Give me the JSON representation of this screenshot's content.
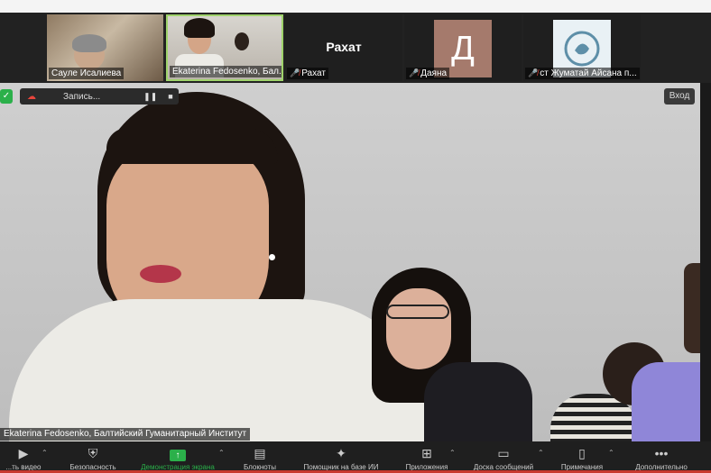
{
  "participants": [
    {
      "name": "Сауле Исалиева",
      "type": "video"
    },
    {
      "name": "Ekaterina Fedosenko, Бал...",
      "type": "video"
    },
    {
      "name": "Рахат",
      "display": "Рахат",
      "type": "name",
      "muted": true
    },
    {
      "name": "Даяна",
      "avatar_letter": "Д",
      "type": "avatar",
      "muted": true
    },
    {
      "name": "ст Жуматай Айсана п...",
      "type": "logo",
      "muted": true
    }
  ],
  "recording": {
    "label": "Запись..."
  },
  "enter_button": "Вход",
  "speaker_label": "Ekaterina Fedosenko, Балтийский Гуманитарный Институт",
  "toolbar": [
    {
      "label": "...ть видео",
      "icon": "video-camera-icon"
    },
    {
      "label": "Безопасность",
      "icon": "shield-icon"
    },
    {
      "label": "Демонстрация экрана",
      "icon": "share-screen-icon"
    },
    {
      "label": "Блокноты",
      "icon": "notebook-icon"
    },
    {
      "label": "Помощник на базе ИИ",
      "icon": "ai-sparkle-icon"
    },
    {
      "label": "Приложения",
      "icon": "apps-icon"
    },
    {
      "label": "Доска сообщений",
      "icon": "whiteboard-icon"
    },
    {
      "label": "Примечания",
      "icon": "notes-icon"
    },
    {
      "label": "Дополнительно",
      "icon": "more-icon"
    }
  ],
  "colors": {
    "share_green": "#2bb04a",
    "muted_red": "#e8453c",
    "active_speaker_border": "#9fd36b"
  }
}
